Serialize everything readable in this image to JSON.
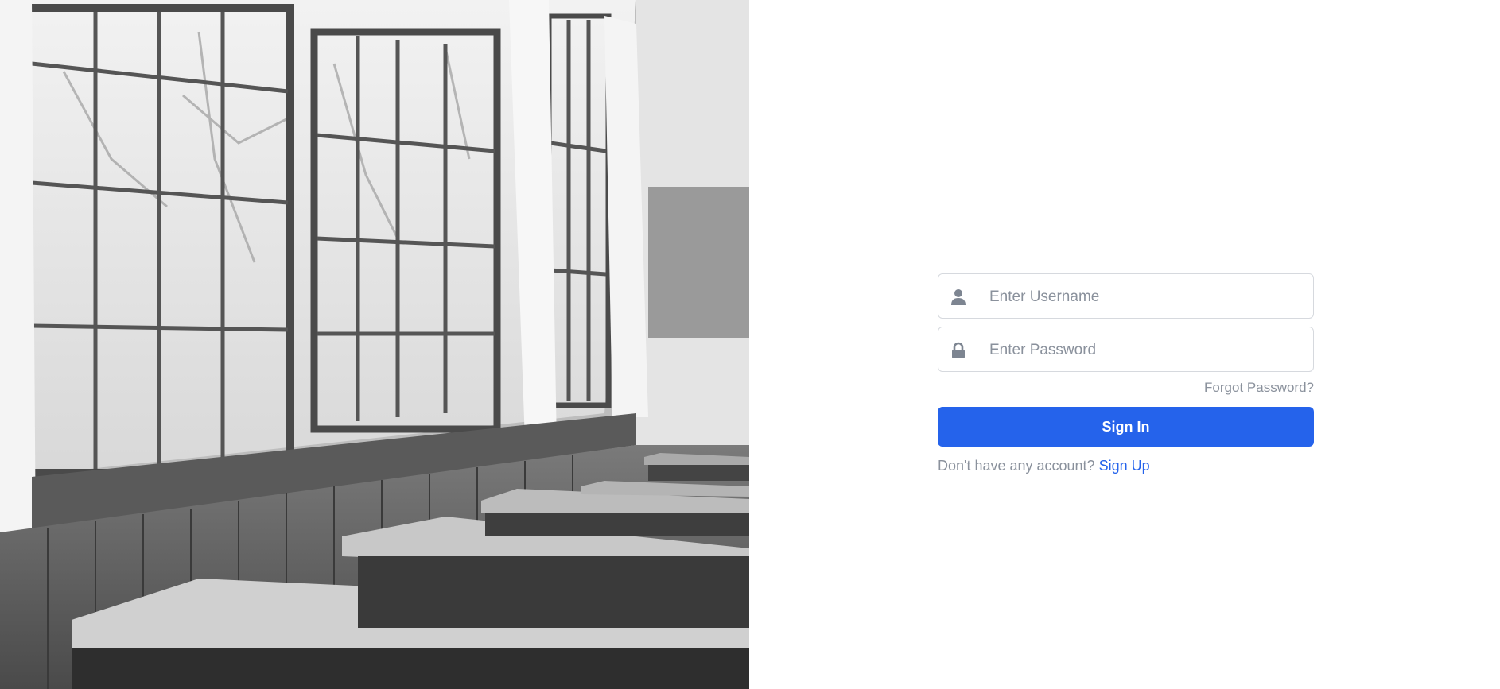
{
  "hero_image": {
    "description_name": "classroom-photo"
  },
  "login": {
    "username": {
      "placeholder": "Enter Username",
      "value": "",
      "icon": "user-icon"
    },
    "password": {
      "placeholder": "Enter Password",
      "value": "",
      "icon": "lock-icon"
    },
    "forgot_label": "Forgot Password?",
    "signin_label": "Sign In",
    "signup_prompt": "Don't have any account?",
    "signup_link": "Sign Up"
  },
  "colors": {
    "accent": "#2563eb",
    "muted_text": "#8a919c",
    "border": "#d6d9de"
  }
}
